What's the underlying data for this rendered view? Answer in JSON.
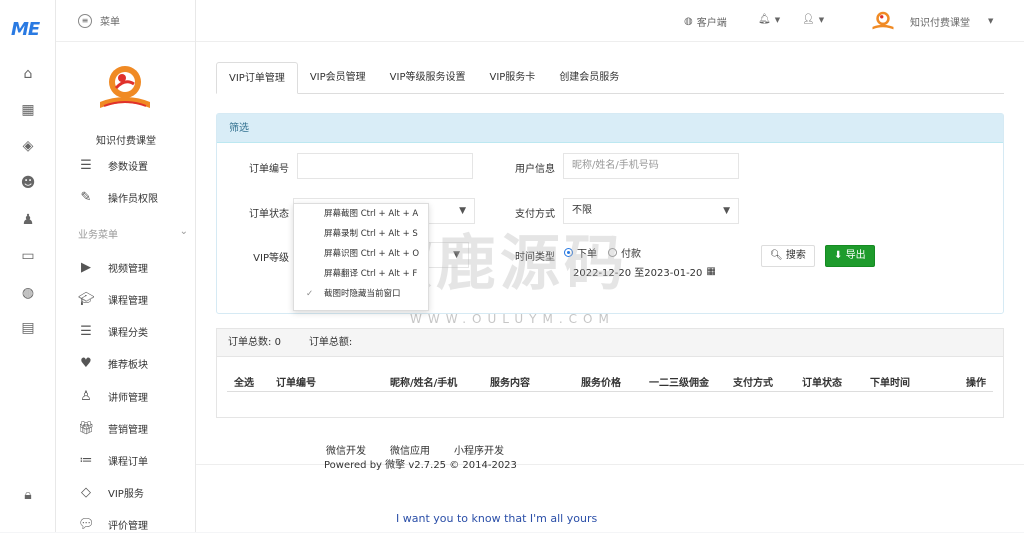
{
  "rail": {
    "logo": "ME",
    "icons": [
      "home-icon",
      "apps-icon",
      "cube-icon",
      "users-icon",
      "user-lock-icon",
      "monitor-icon",
      "globe-icon",
      "store-icon",
      "lock-icon"
    ]
  },
  "topbar": {
    "menu_label": "菜单"
  },
  "header": {
    "client": "客户端",
    "bell": "",
    "user": "",
    "org_name": "知识付费课堂"
  },
  "sidebar": {
    "brand": "知识付费课堂",
    "items_top": [
      {
        "label": "参数设置",
        "icon": "list-icon"
      },
      {
        "label": "操作员权限",
        "icon": "file-edit-icon"
      }
    ],
    "group_label": "业务菜单",
    "items": [
      {
        "label": "视频管理",
        "icon": "play-icon"
      },
      {
        "label": "课程管理",
        "icon": "graduation-cap-icon"
      },
      {
        "label": "课程分类",
        "icon": "list-icon"
      },
      {
        "label": "推荐板块",
        "icon": "heart-icon"
      },
      {
        "label": "讲师管理",
        "icon": "teacher-icon"
      },
      {
        "label": "营销管理",
        "icon": "gift-icon"
      },
      {
        "label": "课程订单",
        "icon": "ordered-list-icon"
      },
      {
        "label": "VIP服务",
        "icon": "diamond-icon"
      },
      {
        "label": "评价管理",
        "icon": "comment-icon"
      }
    ]
  },
  "tabs": [
    "VIP订单管理",
    "VIP会员管理",
    "VIP等级服务设置",
    "VIP服务卡",
    "创建会员服务"
  ],
  "filter": {
    "title": "筛选",
    "order_no_label": "订单编号",
    "order_no_value": "",
    "user_info_label": "用户信息",
    "user_info_placeholder": "昵称/姓名/手机号码",
    "order_status_label": "订单状态",
    "order_status_value": "",
    "pay_method_label": "支付方式",
    "pay_method_value": "不限",
    "vip_level_label": "VIP等级",
    "time_type_label": "时间类型",
    "radio_order": "下单",
    "radio_pay": "付款",
    "date_range": "2022-12-20 至2023-01-20",
    "search_btn": "搜索",
    "export_btn": "导出"
  },
  "context_menu": [
    {
      "label": "屏幕截图 Ctrl + Alt + A",
      "checked": false
    },
    {
      "label": "屏幕录制 Ctrl + Alt + S",
      "checked": false
    },
    {
      "label": "屏幕识图 Ctrl + Alt + O",
      "checked": false
    },
    {
      "label": "屏幕翻译 Ctrl + Alt + F",
      "checked": false
    },
    {
      "label": "截图时隐藏当前窗口",
      "checked": true
    }
  ],
  "results": {
    "total_orders_label": "订单总数:",
    "total_orders_value": "0",
    "total_amount_label": "订单总额:",
    "columns": [
      "全选",
      "订单编号",
      "昵称/姓名/手机",
      "服务内容",
      "服务价格",
      "一二三级佣金",
      "支付方式",
      "订单状态",
      "下单时间",
      "操作"
    ]
  },
  "footer": {
    "links": [
      "微信开发",
      "微信应用",
      "小程序开发"
    ],
    "copyright": "Powered by 微擎 v2.7.25 © 2014-2023"
  },
  "caption": "I want you to know that I'm all yours",
  "watermark": {
    "main": "欧鹿源码",
    "sub": "WWW.OULUYM.COM"
  },
  "colors": {
    "accent": "#2a7ae2",
    "success": "#1e9b2c",
    "panel_head": "#d9edf7"
  }
}
